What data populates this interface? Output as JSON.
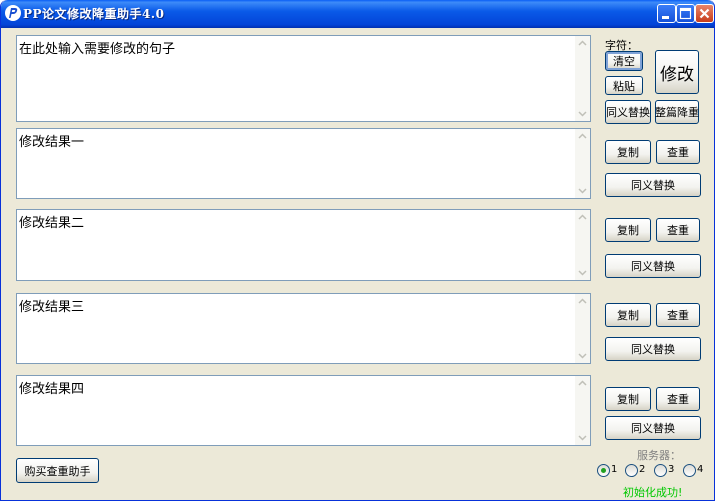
{
  "window": {
    "title": "PP论文修改降重助手4.0"
  },
  "input_area": {
    "text": "在此处输入需要修改的句子"
  },
  "results": [
    {
      "text": "修改结果一",
      "copy_label": "复制",
      "check_label": "查重",
      "synonym_label": "同义替换"
    },
    {
      "text": "修改结果二",
      "copy_label": "复制",
      "check_label": "查重",
      "synonym_label": "同义替换"
    },
    {
      "text": "修改结果三",
      "copy_label": "复制",
      "check_label": "查重",
      "synonym_label": "同义替换"
    },
    {
      "text": "修改结果四",
      "copy_label": "复制",
      "check_label": "查重",
      "synonym_label": "同义替换"
    }
  ],
  "controls": {
    "chars_label": "字符：",
    "clear_label": "清空",
    "paste_label": "粘贴",
    "modify_label": "修改",
    "synonym_label": "同义替换",
    "full_reduce_label": "整篇降重"
  },
  "footer": {
    "buy_label": "购买查重助手",
    "server_label": "服务器：",
    "servers": [
      "1",
      "2",
      "3",
      "4"
    ],
    "selected_server": "1",
    "status_text": "初始化成功!",
    "status_color": "#00c800"
  },
  "icons": {
    "app": "pp-logo-icon",
    "minimize": "minimize-icon",
    "maximize": "maximize-icon",
    "close": "close-icon"
  }
}
